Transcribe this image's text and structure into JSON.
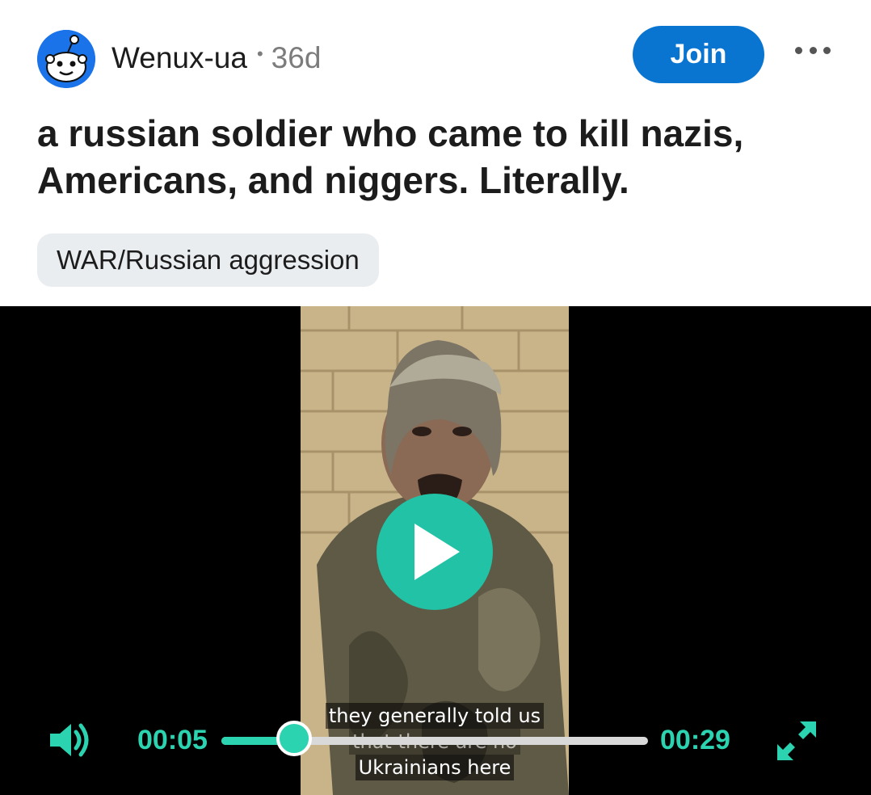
{
  "post": {
    "username": "Wenux-ua",
    "separator": "•",
    "age": "36d",
    "join_label": "Join",
    "title": "a russian soldier who came to kill nazis, Americans, and niggers. Literally.",
    "flair": "WAR/Russian aggression"
  },
  "video": {
    "subtitle_line1": "they generally told us",
    "subtitle_line2": "that there are no",
    "subtitle_line3": "Ukrainians here",
    "current_time": "00:05",
    "duration": "00:29",
    "progress_fraction": 0.17
  },
  "colors": {
    "accent": "#2bd3b1",
    "join_button": "#0a75d1"
  },
  "icons": {
    "avatar": "snoo-avatar-icon",
    "more": "more-options-icon",
    "play": "play-icon",
    "volume": "volume-icon",
    "fullscreen": "fullscreen-expand-icon"
  }
}
